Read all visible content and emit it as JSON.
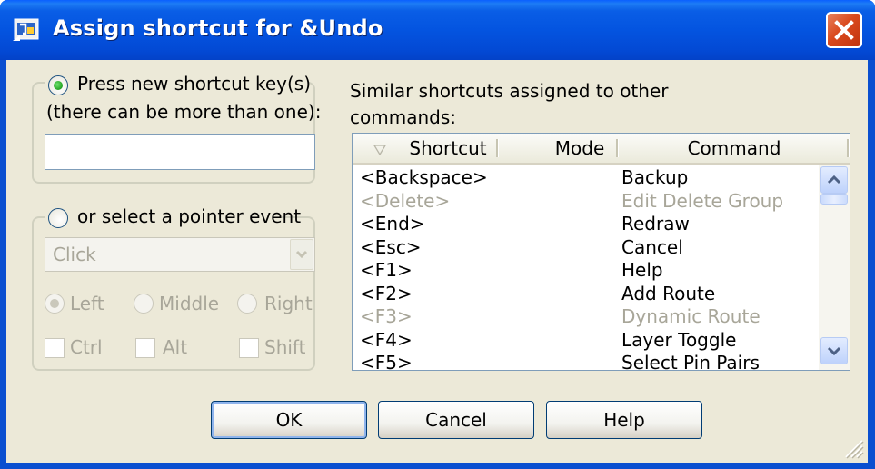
{
  "window": {
    "title": "Assign shortcut for &Undo",
    "close_icon": "close-icon"
  },
  "keys_section": {
    "radio_label": "Press new shortcut key(s)",
    "sub_label": "(there can be more than one):",
    "shortcut_value": "",
    "selected": true
  },
  "pointer_section": {
    "radio_label": "or select a pointer event",
    "selected": false,
    "event_value": "Click",
    "buttons": [
      "Left",
      "Middle",
      "Right"
    ],
    "selected_button": "Left",
    "modifiers": [
      "Ctrl",
      "Alt",
      "Shift"
    ]
  },
  "similar": {
    "label_line1": "Similar shortcuts assigned to other",
    "label_line2": "commands:",
    "columns": [
      "Shortcut",
      "Mode",
      "Command"
    ],
    "rows": [
      {
        "shortcut": "<Backspace>",
        "mode": "",
        "command": "Backup",
        "enabled": true
      },
      {
        "shortcut": "<Delete>",
        "mode": "",
        "command": "Edit Delete Group",
        "enabled": false
      },
      {
        "shortcut": "<End>",
        "mode": "",
        "command": "Redraw",
        "enabled": true
      },
      {
        "shortcut": "<Esc>",
        "mode": "",
        "command": "Cancel",
        "enabled": true
      },
      {
        "shortcut": "<F1>",
        "mode": "",
        "command": "Help",
        "enabled": true
      },
      {
        "shortcut": "<F2>",
        "mode": "",
        "command": "Add Route",
        "enabled": true
      },
      {
        "shortcut": "<F3>",
        "mode": "",
        "command": "Dynamic Route",
        "enabled": false
      },
      {
        "shortcut": "<F4>",
        "mode": "",
        "command": "Layer Toggle",
        "enabled": true
      },
      {
        "shortcut": "<F5>",
        "mode": "",
        "command": "Select Pin Pairs",
        "enabled": true
      }
    ]
  },
  "buttons": {
    "ok": "OK",
    "cancel": "Cancel",
    "help": "Help"
  },
  "colors": {
    "titlebar": "#0454e0",
    "face": "#ece9d8",
    "disabled_text": "#a8a699",
    "close_button": "#d9491d"
  }
}
